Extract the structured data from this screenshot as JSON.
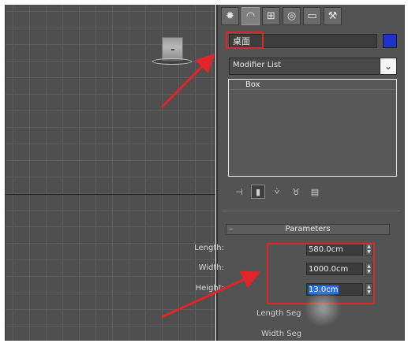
{
  "command_panel": {
    "tabs": [
      {
        "name": "create-tab",
        "glyph": "✹"
      },
      {
        "name": "modify-tab",
        "glyph": "◠"
      },
      {
        "name": "hierarchy-tab",
        "glyph": "⊞"
      },
      {
        "name": "motion-tab",
        "glyph": "◎"
      },
      {
        "name": "display-tab",
        "glyph": "▭"
      },
      {
        "name": "utilities-tab",
        "glyph": "⚒"
      }
    ],
    "object_name": "桌面",
    "object_color": "#1f33c9",
    "modifier_list_label": "Modifier List",
    "modifier_stack": [
      "Box"
    ]
  },
  "parameters": {
    "header": "Parameters",
    "length_label": "Length:",
    "length_value": "580.0cm",
    "width_label": "Width:",
    "width_value": "1000.0cm",
    "height_label": "Height:",
    "height_value": "13.0cm",
    "length_segs_label": "Length Seg",
    "width_segs_label": "Width Seg"
  },
  "annotation_color": "#e0262b"
}
